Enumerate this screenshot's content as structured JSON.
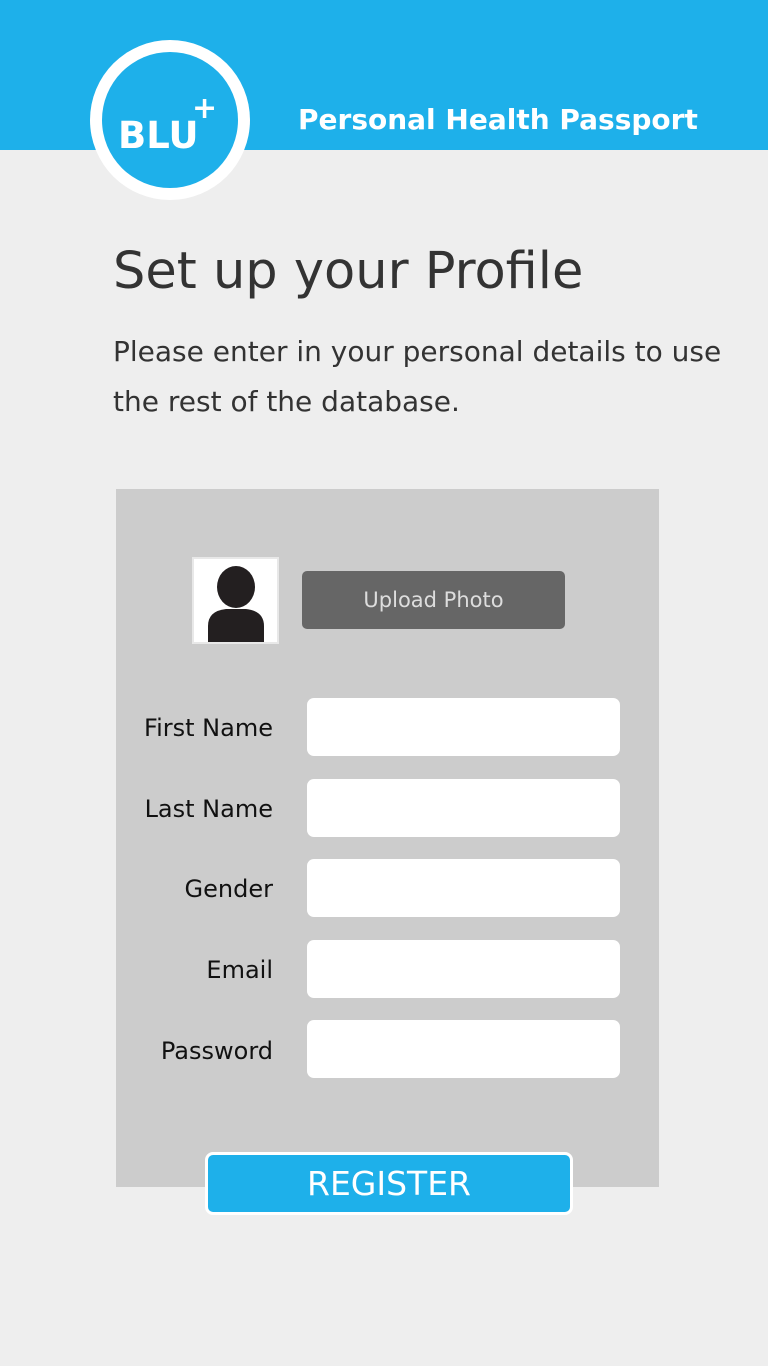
{
  "header": {
    "logo_text": "BLU",
    "logo_plus": "+",
    "app_title": "Personal Health Passport"
  },
  "page": {
    "title": "Set up your Profile",
    "subtitle": "Please enter in your personal details to use the rest of the database."
  },
  "profile": {
    "upload_label": "Upload Photo"
  },
  "form": {
    "fields": [
      {
        "label": "First Name",
        "value": "",
        "placeholder": ""
      },
      {
        "label": "Last Name",
        "value": "",
        "placeholder": ""
      },
      {
        "label": "Gender",
        "value": "",
        "placeholder": ""
      },
      {
        "label": "Email",
        "value": "",
        "placeholder": ""
      },
      {
        "label": "Password",
        "value": "",
        "placeholder": ""
      }
    ],
    "register_label": "REGISTER"
  },
  "colors": {
    "brand_blue": "#1eb0ea",
    "background": "#eeeeee",
    "panel": "#cccccc",
    "upload_button": "#666666"
  },
  "icons": {
    "avatar": "user-silhouette-icon"
  }
}
